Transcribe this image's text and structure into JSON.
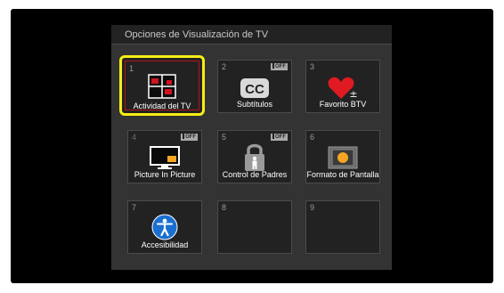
{
  "panel": {
    "title": "Opciones de Visualización de TV"
  },
  "tiles": [
    {
      "number": "1",
      "label": "Actividad del TV",
      "icon": "tv-activity-icon",
      "off": ""
    },
    {
      "number": "2",
      "label": "Subtítulos",
      "icon": "cc-icon",
      "off": "OFF"
    },
    {
      "number": "3",
      "label": "Favorito BTV",
      "icon": "heart-plus-minus-icon",
      "off": ""
    },
    {
      "number": "4",
      "label": "Picture In Picture",
      "icon": "pip-icon",
      "off": "OFF"
    },
    {
      "number": "5",
      "label": "Control de Padres",
      "icon": "padlock-icon",
      "off": "OFF"
    },
    {
      "number": "6",
      "label": "Formato de Pantalla",
      "icon": "screen-format-icon",
      "off": ""
    },
    {
      "number": "7",
      "label": "Accesibilidad",
      "icon": "accessibility-icon",
      "off": ""
    },
    {
      "number": "8",
      "label": "",
      "icon": "",
      "off": ""
    },
    {
      "number": "9",
      "label": "",
      "icon": "",
      "off": ""
    }
  ],
  "colors": {
    "selection_border": "#f5ee14",
    "accent_red": "#d2121f",
    "accessibility_blue": "#1b6fd2",
    "screen_orange": "#f5a623"
  }
}
